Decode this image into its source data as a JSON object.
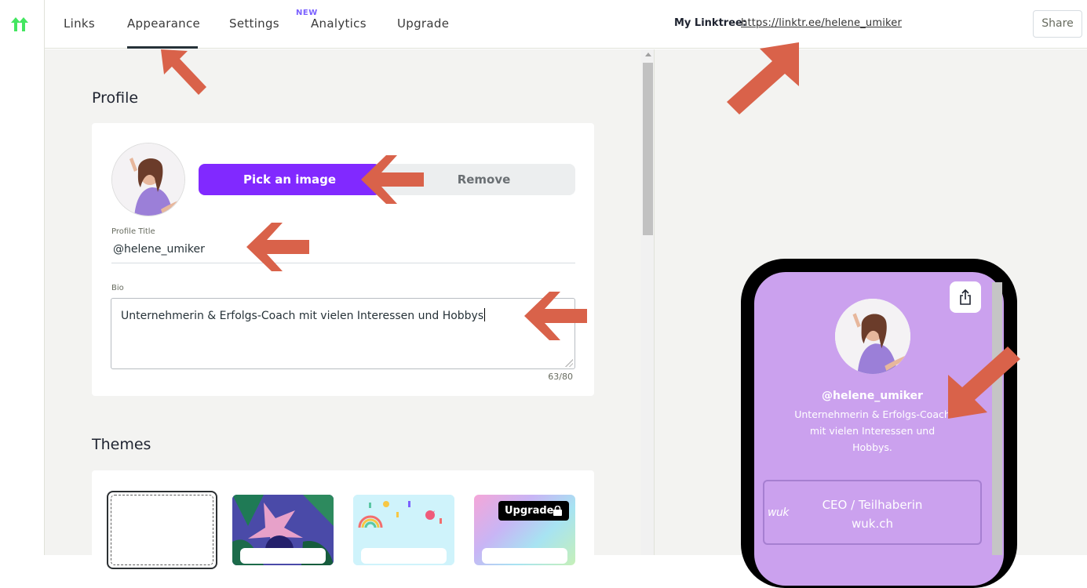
{
  "brand": {
    "accent": "#8129ff",
    "logo_color": "#43e660",
    "arrow_color": "#d9624a",
    "preview_bg": "#cba1ee"
  },
  "nav": {
    "tabs": [
      {
        "label": "Links"
      },
      {
        "label": "Appearance"
      },
      {
        "label": "Settings"
      },
      {
        "label": "Analytics"
      },
      {
        "label": "Upgrade"
      }
    ],
    "new_badge": "NEW",
    "active_tab": "Appearance"
  },
  "profile": {
    "section_title": "Profile",
    "pick_image_label": "Pick an image",
    "remove_label": "Remove",
    "title_label": "Profile Title",
    "title_value": "@helene_umiker",
    "bio_label": "Bio",
    "bio_value": "Unternehmerin & Erfolgs-Coach mit vielen Interessen und Hobbys",
    "bio_counter": "63/80"
  },
  "themes": {
    "section_title": "Themes",
    "upgrade_badge": "Upgrade"
  },
  "header_right": {
    "my_linktree_label": "My Linktree:",
    "url": "https://linktr.ee/helene_umiker",
    "share_label": "Share"
  },
  "preview": {
    "name": "@helene_umiker",
    "bio": "Unternehmerin & Erfolgs-Coach mit vielen Interessen und Hobbys.",
    "link_title_line1": "CEO / Teilhaberin",
    "link_title_line2": "wuk.ch",
    "link_logo": "wuk"
  },
  "icons": [
    "linktree-logo-icon",
    "share-icon",
    "lock-icon",
    "annotation-arrow"
  ]
}
